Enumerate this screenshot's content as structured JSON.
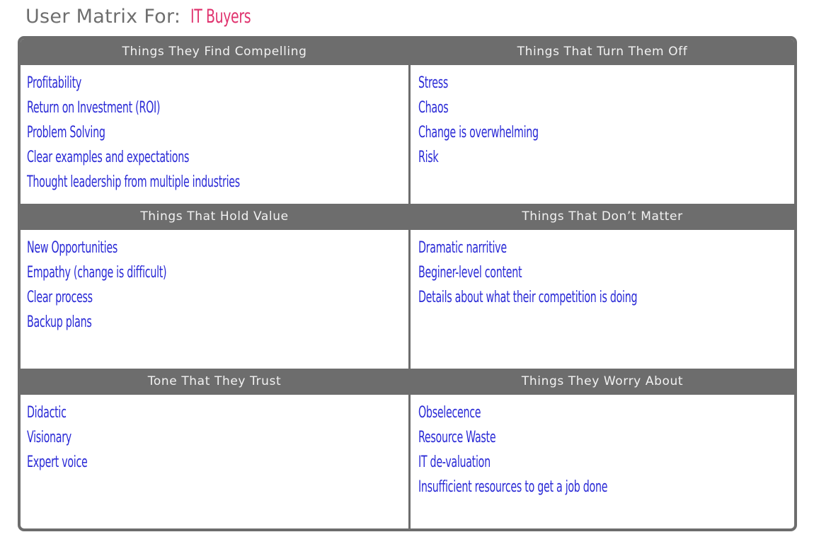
{
  "title": {
    "label": "User Matrix For:",
    "subject": "IT Buyers"
  },
  "colors": {
    "header_bg": "#6d6d6d",
    "header_text": "#f2f2f2",
    "item_text": "#2a2ad6",
    "subject_text": "#e0336e",
    "title_text": "#6e6e6e"
  },
  "quadrants": [
    {
      "title": "Things They Find Compelling",
      "items": [
        "Profitability",
        "Return on Investment (ROI)",
        "Problem Solving",
        "Clear examples and expectations",
        "Thought leadership from multiple industries"
      ]
    },
    {
      "title": "Things That Turn Them Off",
      "items": [
        "Stress",
        "Chaos",
        "Change is overwhelming",
        "Risk"
      ]
    },
    {
      "title": "Things That Hold Value",
      "items": [
        "New Opportunities",
        "Empathy (change is difficult)",
        "Clear process",
        "Backup plans"
      ]
    },
    {
      "title": "Things That Don’t Matter",
      "items": [
        "Dramatic narritive",
        "Beginer-level content",
        "Details about what their competition is doing"
      ]
    },
    {
      "title": "Tone That They Trust",
      "items": [
        "Didactic",
        "Visionary",
        "Expert voice"
      ]
    },
    {
      "title": "Things They Worry About",
      "items": [
        "Obselecence",
        "Resource Waste",
        "IT de-valuation",
        "Insufficient resources to get a job done"
      ]
    }
  ]
}
